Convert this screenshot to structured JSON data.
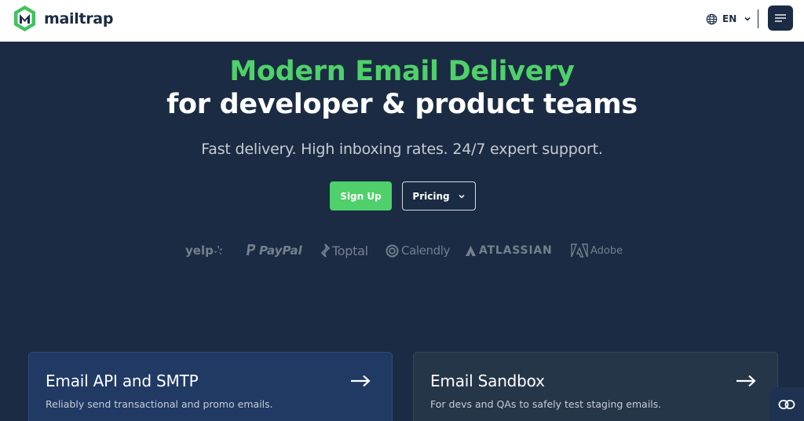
{
  "header": {
    "logo_text": "mailtrap",
    "language": "EN"
  },
  "hero": {
    "title_line1": "Modern Email Delivery",
    "title_line2": "for developer & product teams",
    "subtitle": "Fast delivery. High inboxing rates. 24/7 expert support.",
    "signup_label": "Sign Up",
    "pricing_label": "Pricing"
  },
  "brands": [
    "yelp",
    "PayPal",
    "Toptal",
    "Calendly",
    "ATLASSIAN",
    "Adobe"
  ],
  "cards": [
    {
      "title": "Email API and SMTP",
      "description": "Reliably send transactional and promo emails."
    },
    {
      "title": "Email Sandbox",
      "description": "For devs and QAs to safely test staging emails."
    }
  ],
  "icons": {
    "logo": "mailtrap-logo-icon",
    "language": "globe-icon",
    "language_toggle": "chevron-down-icon",
    "menu": "hamburger-menu-icon",
    "pricing_toggle": "chevron-down-icon",
    "card_link": "arrow-right-icon",
    "chat": "chat-widget-icon"
  },
  "colors": {
    "background": "#1b2b43",
    "accent_green": "#4fd06b",
    "header_bg": "#ffffff",
    "card_api_bg": "#203a64",
    "card_sandbox_bg": "#263649",
    "brand_logo_grey": "#74808f"
  }
}
